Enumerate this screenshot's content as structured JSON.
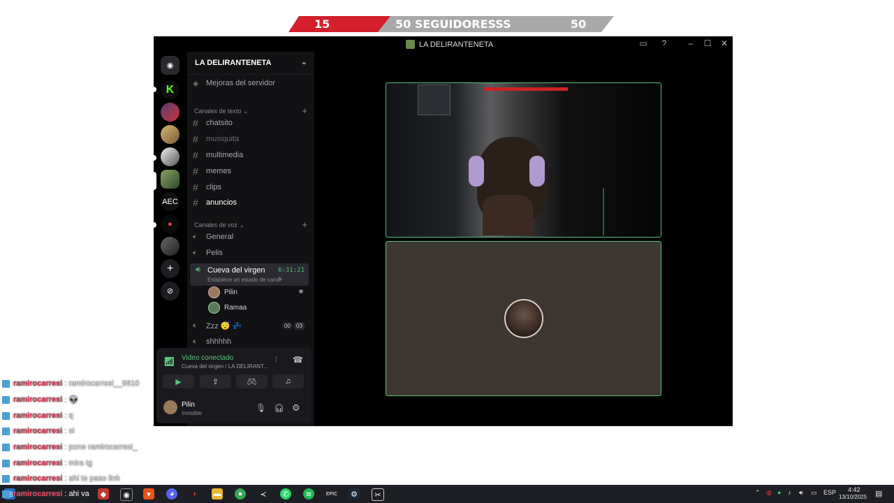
{
  "goal": {
    "current": "15",
    "label": "50 SEGUIDORESSS",
    "target": "50"
  },
  "window": {
    "title": "LA DELIRANTENETA",
    "controls": {
      "minimize": "–",
      "maximize": "☐",
      "close": "✕"
    }
  },
  "servers": {
    "aec_label": "AEC"
  },
  "panel": {
    "server_name": "LA DELIRANTENETA",
    "boost": "Mejoras del servidor",
    "text_category": "Canales de texto",
    "text_channels": [
      {
        "name": "chatsito"
      },
      {
        "name": "musiquita"
      },
      {
        "name": "multimedia"
      },
      {
        "name": "memes"
      },
      {
        "name": "clips"
      },
      {
        "name": "anuncios"
      }
    ],
    "voice_category": "Canales de voz",
    "voice_channels": {
      "general": "General",
      "pelis": "Pelis",
      "cueva": "Cueva del virgen",
      "cueva_timer": "6:31:21",
      "cueva_status": "Establece un estado de canal",
      "users": [
        {
          "name": "Pilin"
        },
        {
          "name": "Ramaa"
        }
      ],
      "zzz": "Zzz 😴 💤",
      "zzz_count_a": "00",
      "zzz_count_b": "03",
      "shhhhh": "shhhhh"
    },
    "connection": {
      "title": "Video conectado",
      "subtitle": "Cueva del virgen / LA DELIRANT..."
    },
    "user": {
      "name": "Pilin",
      "status": "Invisible"
    }
  },
  "chat_overlay": [
    {
      "user": "ramirocarresi",
      "text": ": ramirocarresi__9610"
    },
    {
      "user": "ramirocarresi",
      "text": ": 👽"
    },
    {
      "user": "ramirocarresi",
      "text": ": q"
    },
    {
      "user": "ramirocarresi",
      "text": ": si"
    },
    {
      "user": "ramirocarresi",
      "text": ": pone ramirocarresi_"
    },
    {
      "user": "ramirocarresi",
      "text": ": mira tg"
    },
    {
      "user": "ramirocarresi",
      "text": ": ahi te paso link"
    },
    {
      "user": "ramirocarresi",
      "text": ": ahi va"
    }
  ],
  "taskbar": {
    "lang": "ESP",
    "time": "4:42",
    "date": "13/10/2025"
  },
  "colors": {
    "accent_green": "#57c27a",
    "goal_red": "#d41f2c",
    "chat_name": "#e9435e"
  }
}
